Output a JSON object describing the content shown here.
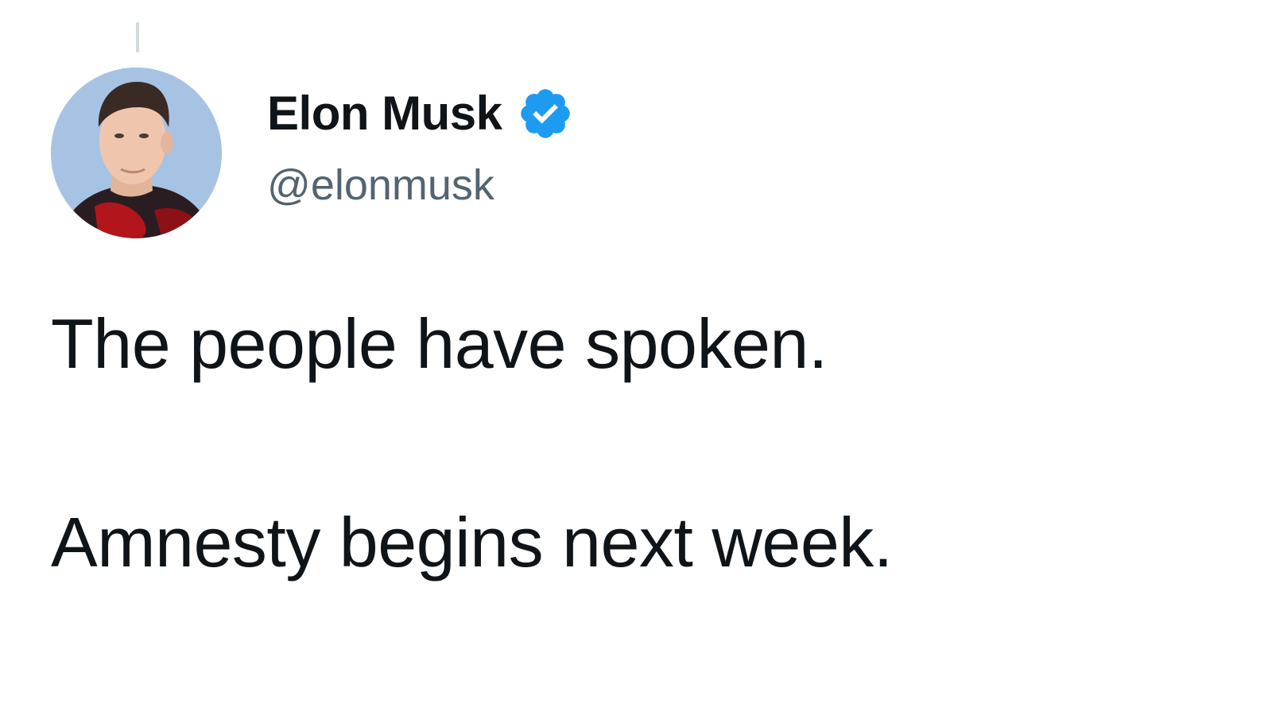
{
  "author": {
    "display_name": "Elon Musk",
    "handle": "@elonmusk",
    "verified": true,
    "verified_color": "#1d9bf0",
    "avatar_icon": "profile-photo"
  },
  "tweet": {
    "lines": [
      "The people have spoken.",
      "Amnesty begins next week."
    ]
  },
  "colors": {
    "text_primary": "#0f1419",
    "text_secondary": "#536471",
    "background": "#ffffff"
  }
}
